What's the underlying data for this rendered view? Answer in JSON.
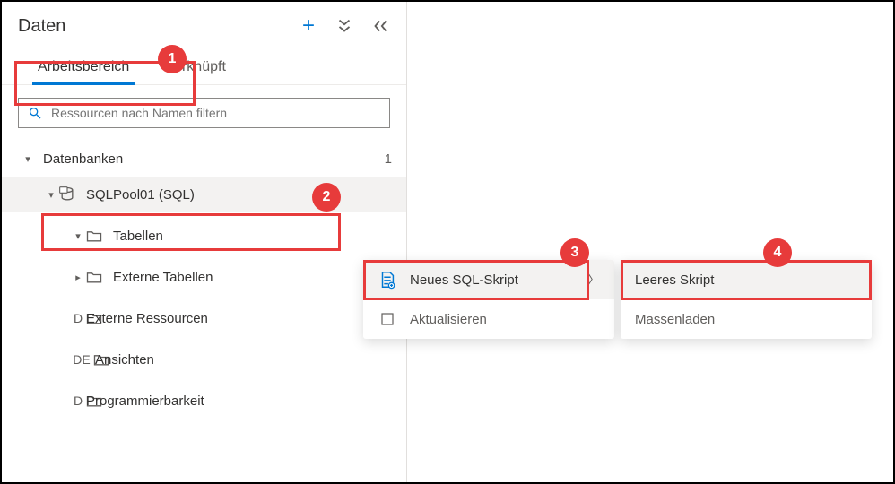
{
  "colors": {
    "accent": "#0078d4",
    "callout": "#e73b3b"
  },
  "header": {
    "title": "Daten"
  },
  "tabs": {
    "workspace": "Arbeitsbereich",
    "linked": "Verknüpft"
  },
  "search": {
    "placeholder": "Ressourcen nach Namen filtern"
  },
  "tree": {
    "databases_label": "Datenbanken",
    "databases_count": "1",
    "pool_label": "SQLPool01 (SQL)",
    "children": {
      "tables": "Tabellen",
      "ext_tables": "Externe Tabellen",
      "ext_resources": "Externe Ressourcen",
      "views": "Ansichten",
      "programmability": "Programmierbarkeit"
    },
    "prefix_letters": {
      "d1": "D",
      "d2": "DE",
      "d3": "D"
    }
  },
  "menu1": {
    "new_sql_label": "Neues SQL-Skript",
    "refresh_label": "Aktualisieren"
  },
  "menu2": {
    "empty_label": "Leeres Skript",
    "bulk_label": "Massenladen"
  },
  "callouts": {
    "c1": "1",
    "c2": "2",
    "c3": "3",
    "c4": "4"
  }
}
